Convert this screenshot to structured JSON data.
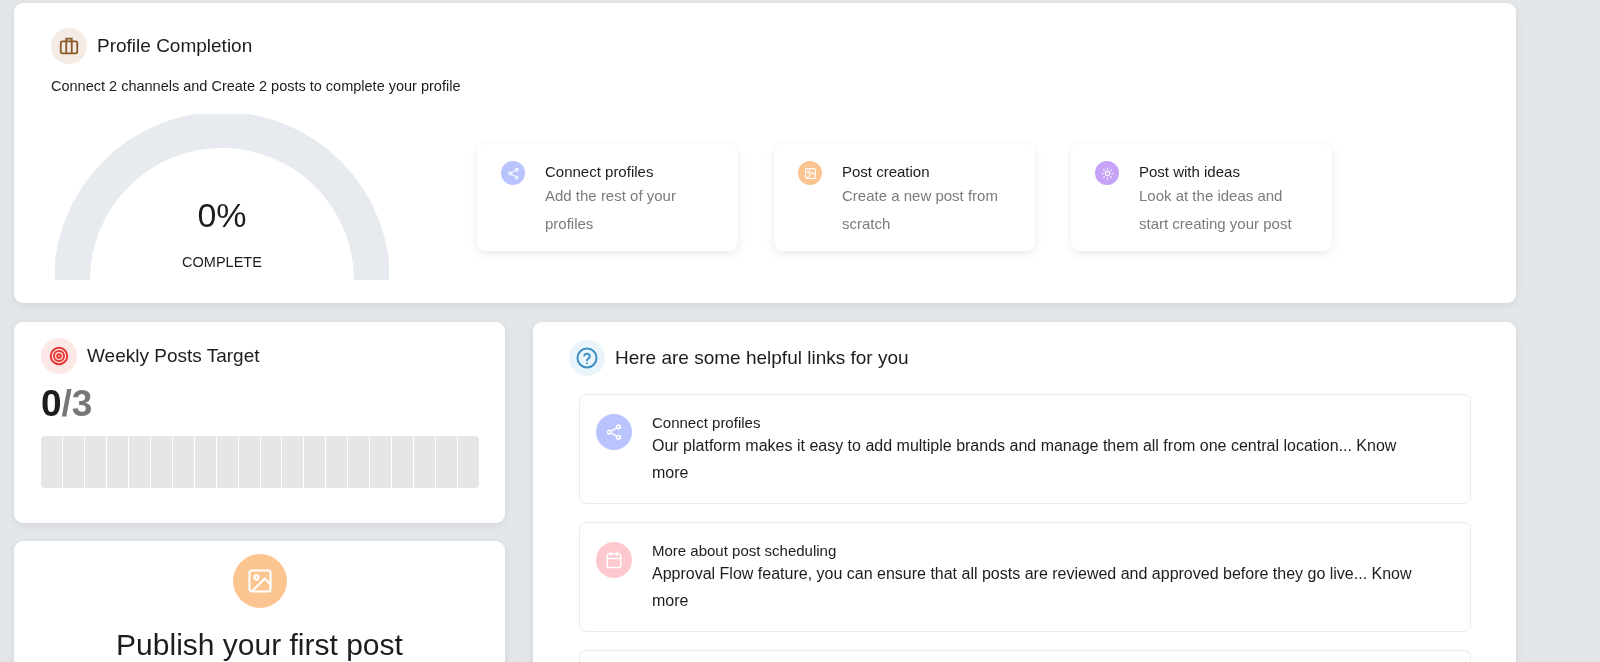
{
  "profile_completion": {
    "title": "Profile Completion",
    "subtitle": "Connect 2 channels and Create 2 posts to complete your profile",
    "gauge": {
      "level": 0,
      "value": "0%",
      "label": "COMPLETE"
    },
    "steps": [
      {
        "kind": "share",
        "color": "#b9c3fd",
        "title": "Connect profiles",
        "description": "Add the rest of your profiles"
      },
      {
        "kind": "image",
        "color": "#fbc490",
        "title": "Post creation",
        "description": "Create a new post from scratch"
      },
      {
        "kind": "bulb",
        "color": "#c6a3f7",
        "title": "Post with ideas",
        "description": "Look at the ideas and start creating your post"
      }
    ]
  },
  "weekly_target": {
    "title": "Weekly Posts Target",
    "done": "0",
    "total": "/3",
    "level": 0
  },
  "publish": {
    "title": "Publish your first post"
  },
  "helpful_links": {
    "title": "Here are some helpful links for you",
    "items": [
      {
        "kind": "share",
        "color": "#b9c3fd",
        "title": "Connect profiles",
        "description": "Our platform makes it easy to add multiple brands and manage them all from one central location... Know more"
      },
      {
        "kind": "calendar",
        "color": "#fdc9cf",
        "title": "More about post scheduling",
        "description": "Approval Flow feature, you can ensure that all posts are reviewed and approved before they go live... Know more"
      }
    ]
  }
}
